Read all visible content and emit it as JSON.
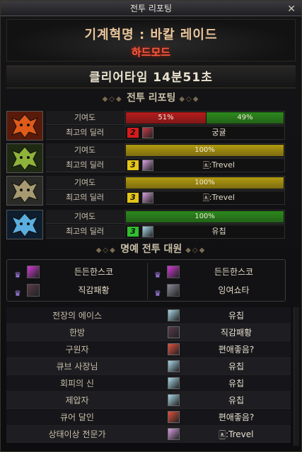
{
  "window": {
    "title": "전투 리포팅",
    "close_label": "✕"
  },
  "raid": {
    "name": "기계혁명 : 바칼 레이드",
    "mode": "하드모드"
  },
  "clear_time": "클리어타임 14분51초",
  "sections": {
    "report": "전투 리포팅",
    "honor": "명예 전투 대원"
  },
  "row_labels": {
    "contribution": "기여도",
    "best_dealer": "최고의 딜러"
  },
  "colors": {
    "red": "#b51c1c",
    "green": "#2c8a1c",
    "gold": "#b29a10",
    "rank2": "#d81a1a",
    "rank3": "#e3c51a",
    "rank3g": "#2fbf2f"
  },
  "parties": [
    {
      "icon": "fire-dragon-icon",
      "bars": [
        {
          "label": "51%",
          "percent": 51,
          "color": "#b51c1c"
        },
        {
          "label": "49%",
          "percent": 49,
          "color": "#2c8a1c"
        }
      ],
      "rank": "2",
      "rank_color": "#d81a1a",
      "dealer": "궁귤",
      "ava": "#c8384a"
    },
    {
      "icon": "green-dragon-icon",
      "bars": [
        {
          "label": "100%",
          "percent": 100,
          "color": "#b29a10"
        }
      ],
      "rank": "3",
      "rank_color": "#e3c51a",
      "dealer": "🀀:Trevel",
      "ava": "#d9a0e0"
    },
    {
      "icon": "grey-dragon-icon",
      "bars": [
        {
          "label": "100%",
          "percent": 100,
          "color": "#b29a10"
        }
      ],
      "rank": "3",
      "rank_color": "#e3c51a",
      "dealer": "🀀:Trevel",
      "ava": "#d9a0e0"
    },
    {
      "icon": "ice-dragon-icon",
      "bars": [
        {
          "label": "100%",
          "percent": 100,
          "color": "#2c8a1c"
        }
      ],
      "rank": "3",
      "rank_color": "#2fbf2f",
      "dealer": "유칩",
      "ava": "#a8d8e8"
    }
  ],
  "honor_members": [
    {
      "name": "든든한스코",
      "ava": "#d23ad6"
    },
    {
      "name": "든든한스코",
      "ava": "#d23ad6"
    },
    {
      "name": "직감패황",
      "ava": "#5a3b4a"
    },
    {
      "name": "잉여쇼타",
      "ava": "#8a8a9a"
    }
  ],
  "awards": [
    {
      "title": "전장의 에이스",
      "name": "유칩",
      "ava": "#a8d8e8"
    },
    {
      "title": "한방",
      "name": "직감패황",
      "ava": "#5a3b4a"
    },
    {
      "title": "구원자",
      "name": "편애좋음?",
      "ava": "#e0503c"
    },
    {
      "title": "큐브 사장님",
      "name": "유칩",
      "ava": "#a8d8e8"
    },
    {
      "title": "회피의 신",
      "name": "유칩",
      "ava": "#a8d8e8"
    },
    {
      "title": "제압자",
      "name": "유칩",
      "ava": "#a8d8e8"
    },
    {
      "title": "큐어 달인",
      "name": "편애좋음?",
      "ava": "#e0503c"
    },
    {
      "title": "상태이상 전문가",
      "name": "🀀:Trevel",
      "ava": "#d9a0e0"
    }
  ]
}
